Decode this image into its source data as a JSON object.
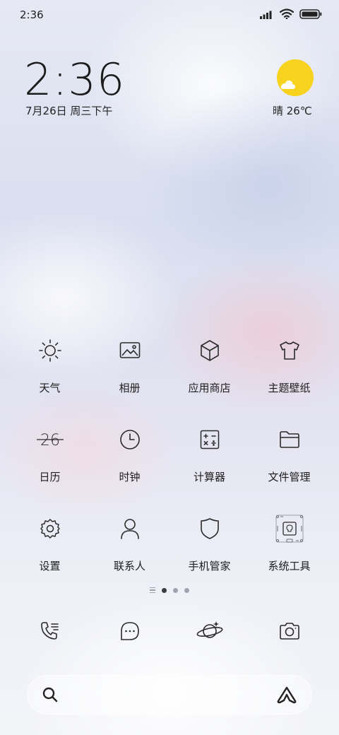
{
  "status_bar": {
    "time": "2:36",
    "battery_level": 1.0,
    "icons": [
      "signal-icon",
      "wifi-icon",
      "battery-icon"
    ]
  },
  "clock_widget": {
    "time": "2:36",
    "date": "7月26日 周三下午"
  },
  "weather_widget": {
    "icon": "partly-sunny-icon",
    "text": "晴 26℃",
    "sun_color": "#f7d21e"
  },
  "apps": [
    {
      "label": "天气",
      "icon": "sun-icon"
    },
    {
      "label": "相册",
      "icon": "gallery-icon"
    },
    {
      "label": "应用商店",
      "icon": "app-store-icon"
    },
    {
      "label": "主题壁纸",
      "icon": "theme-shirt-icon"
    },
    {
      "label": "日历",
      "icon": "calendar-icon",
      "icon_text": "26"
    },
    {
      "label": "时钟",
      "icon": "clock-icon"
    },
    {
      "label": "计算器",
      "icon": "calculator-icon"
    },
    {
      "label": "文件管理",
      "icon": "folder-icon"
    },
    {
      "label": "设置",
      "icon": "gear-icon"
    },
    {
      "label": "联系人",
      "icon": "person-icon"
    },
    {
      "label": "手机管家",
      "icon": "shield-icon"
    },
    {
      "label": "系统工具",
      "icon": "tools-folder-icon"
    }
  ],
  "page_indicator": {
    "pages": 3,
    "active_index": 0
  },
  "dock": [
    {
      "icon": "phone-icon"
    },
    {
      "icon": "message-icon"
    },
    {
      "icon": "browser-planet-icon"
    },
    {
      "icon": "camera-icon"
    }
  ],
  "search_bar": {
    "left_icon": "search-icon",
    "right_icon": "assistant-logo-icon"
  }
}
